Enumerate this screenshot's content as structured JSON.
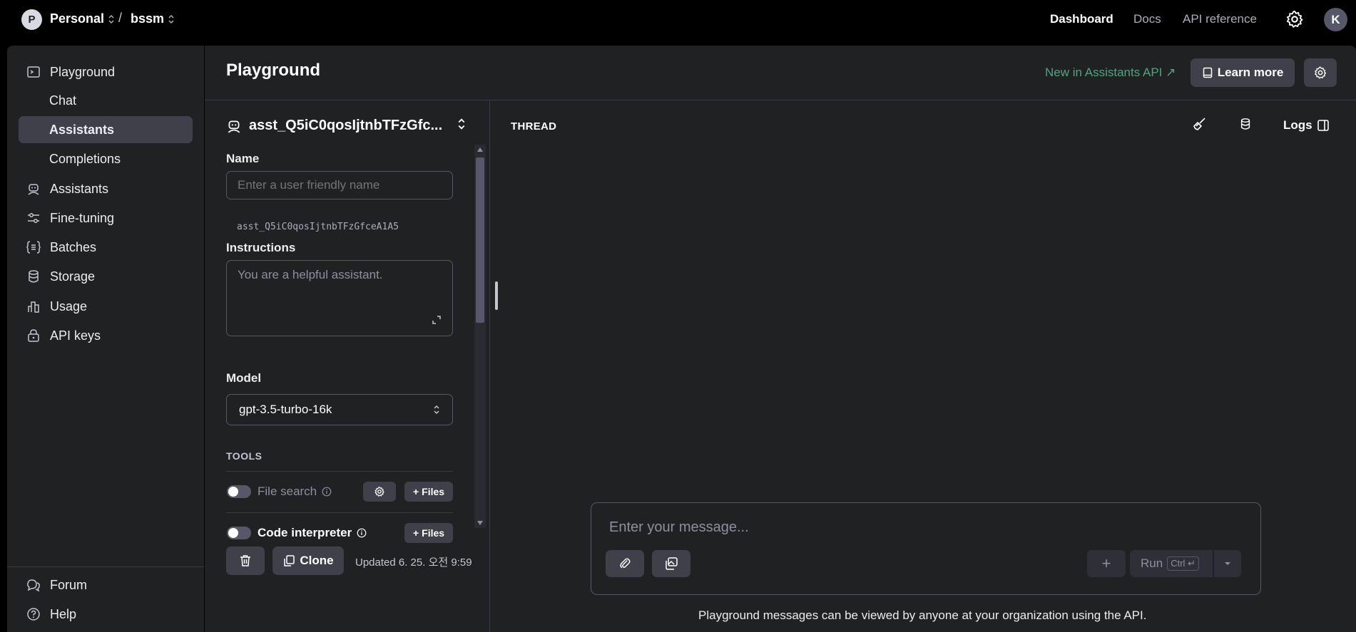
{
  "topbar": {
    "org_initial": "P",
    "org_name": "Personal",
    "separator": "/",
    "project_name": "bssm",
    "nav": [
      "Dashboard",
      "Docs",
      "API reference"
    ],
    "user_initial": "K"
  },
  "sidebar": {
    "items": [
      {
        "label": "Playground",
        "icon": "playground-icon"
      },
      {
        "label": "Chat"
      },
      {
        "label": "Assistants"
      },
      {
        "label": "Completions"
      },
      {
        "label": "Assistants",
        "icon": "assistant-robot-icon"
      },
      {
        "label": "Fine-tuning",
        "icon": "sliders-icon"
      },
      {
        "label": "Batches",
        "icon": "batches-icon"
      },
      {
        "label": "Storage",
        "icon": "database-icon"
      },
      {
        "label": "Usage",
        "icon": "bar-chart-icon"
      },
      {
        "label": "API keys",
        "icon": "lock-icon"
      }
    ],
    "footer": [
      {
        "label": "Forum",
        "icon": "forum-icon"
      },
      {
        "label": "Help",
        "icon": "help-icon"
      }
    ]
  },
  "main": {
    "title": "Playground",
    "new_in_link": "New in Assistants API ↗",
    "learn_more": "Learn more"
  },
  "assistant": {
    "selected_name": "asst_Q5iC0qosIjtnbTFzGfc...",
    "name_label": "Name",
    "name_placeholder": "Enter a user friendly name",
    "id": "asst_Q5iC0qosIjtnbTFzGfceA1A5",
    "instructions_label": "Instructions",
    "instructions_placeholder": "You are a helpful assistant.",
    "model_label": "Model",
    "model_value": "gpt-3.5-turbo-16k",
    "tools_label": "TOOLS",
    "tools": [
      {
        "label": "File search",
        "enabled": false
      },
      {
        "label": "Code interpreter",
        "enabled": false
      }
    ],
    "files_button": "Files",
    "clone_button": "Clone",
    "updated_text": "Updated 6. 25. 오전 9:59"
  },
  "thread": {
    "title": "THREAD",
    "logs_label": "Logs",
    "message_placeholder": "Enter your message...",
    "run_label": "Run",
    "run_shortcut": "Ctrl ↵",
    "footer_note": "Playground messages can be viewed by anyone at your organization using the API."
  },
  "colors": {
    "background": "#202123",
    "topbar": "#000000",
    "accent_green": "#4ea57f",
    "button_bg": "#3f4049"
  }
}
